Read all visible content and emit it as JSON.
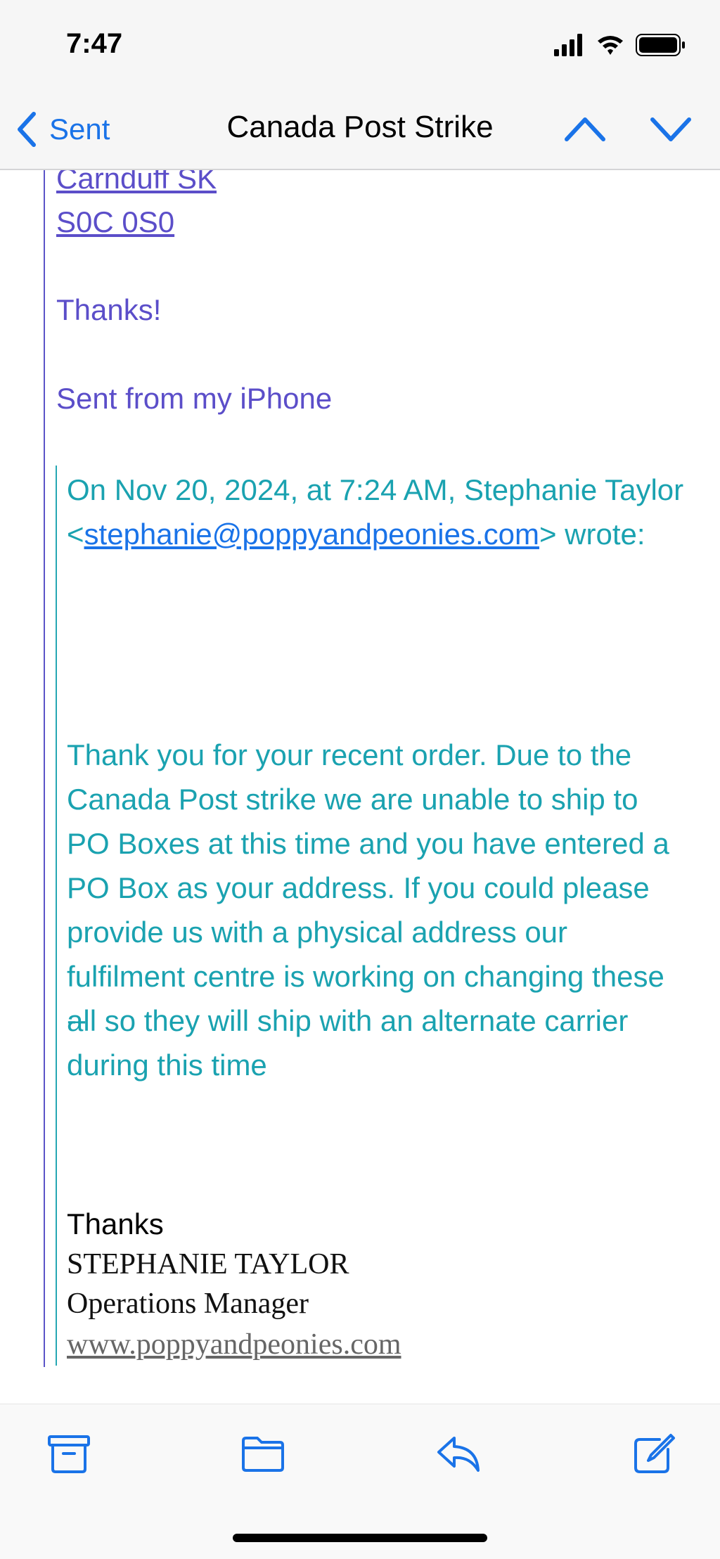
{
  "status_bar": {
    "time": "7:47"
  },
  "nav": {
    "back_label": "Sent",
    "title": "Canada Post Strike"
  },
  "email": {
    "address_line1": "Carnduff SK",
    "address_line2": "S0C 0S0",
    "thanks": "Thanks!",
    "sent_from": "Sent from my iPhone",
    "quote_header_pre": "On Nov 20, 2024, at 7:24 AM, Stephanie Taylor <",
    "quote_header_email": "stephanie@poppyandpeonies.com",
    "quote_header_post": "> wrote:",
    "quote_body": "Thank you for your recent order. Due to the Canada Post strike we are unable to ship to PO Boxes at this time and you have entered a PO Box as your address. If you could please provide us with a physical address our fulfilment centre is working on changing these all so they will ship with an alternate carrier during this time",
    "dashes": "--",
    "sig_thanks": "Thanks",
    "sig_name": "STEPHANIE TAYLOR",
    "sig_title": "Operations Manager",
    "sig_website": "www.poppyandpeonies.com"
  },
  "toolbar": {
    "icons": [
      "archive-icon",
      "folder-icon",
      "reply-icon",
      "compose-icon"
    ]
  },
  "colors": {
    "accent": "#1a73e8",
    "outer_quote_text": "#5b4ec9",
    "inner_quote_text": "#1aa2b0"
  }
}
